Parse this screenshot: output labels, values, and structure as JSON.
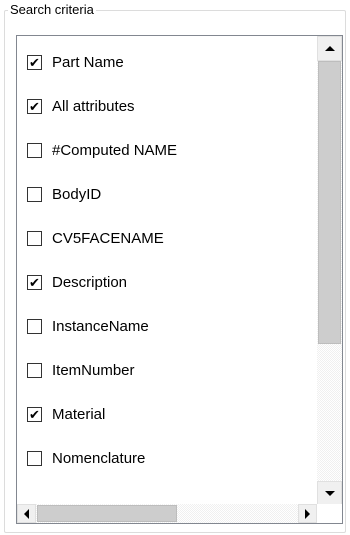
{
  "group": {
    "title": "Search criteria"
  },
  "items": [
    {
      "label": "Part Name",
      "checked": true
    },
    {
      "label": "All attributes",
      "checked": true
    },
    {
      "label": "#Computed NAME",
      "checked": false
    },
    {
      "label": "BodyID",
      "checked": false
    },
    {
      "label": "CV5FACENAME",
      "checked": false
    },
    {
      "label": "Description",
      "checked": true
    },
    {
      "label": "InstanceName",
      "checked": false
    },
    {
      "label": "ItemNumber",
      "checked": false
    },
    {
      "label": "Material",
      "checked": true
    },
    {
      "label": "Nomenclature",
      "checked": false
    }
  ],
  "icons": {
    "checkmark": "check-icon",
    "scroll_up": "arrow-up-icon",
    "scroll_down": "arrow-down-icon",
    "scroll_left": "arrow-left-icon",
    "scroll_right": "arrow-right-icon"
  }
}
